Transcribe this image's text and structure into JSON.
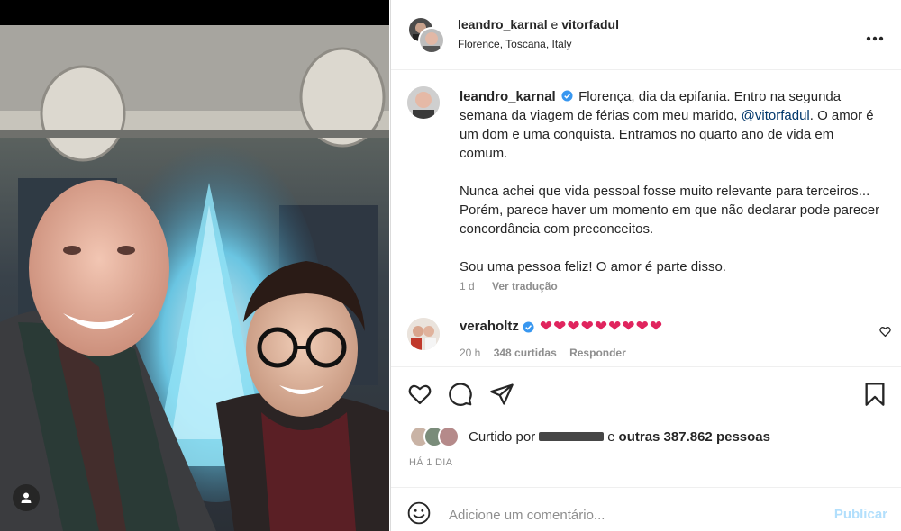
{
  "post": {
    "author": "leandro_karnal",
    "conjunction": "e",
    "coauthor": "vitorfadul",
    "location": "Florence, Toscana, Italy"
  },
  "caption": {
    "username": "leandro_karnal",
    "verified": true,
    "para1_before": "Florença, dia da epifania. Entro na segunda semana da viagem de férias com meu marido, ",
    "mention": "@vitorfadul",
    "para1_after": ". O amor é um dom e uma conquista. Entramos no quarto ano de vida em comum.",
    "para2": "Nunca achei que vida pessoal fosse muito relevante para terceiros... Porém, parece haver um momento em que não declarar pode parecer concordância com preconceitos.",
    "para3": "Sou uma pessoa feliz! O amor é parte disso.",
    "age": "1 d",
    "translate": "Ver tradução"
  },
  "comment": {
    "username": "veraholtz",
    "verified": true,
    "text": "❤❤❤❤❤❤❤❤❤",
    "age": "20 h",
    "likes": "348 curtidas",
    "reply": "Responder"
  },
  "likes": {
    "prefix": "Curtido por",
    "and": "e",
    "others": "outras 387.862 pessoas"
  },
  "timestamp": "HÁ 1 DIA",
  "comment_box": {
    "placeholder": "Adicione um comentário...",
    "publish": "Publicar"
  },
  "icons": {
    "more": "more-options-icon",
    "like": "heart-icon",
    "comment": "comment-icon",
    "share": "share-icon",
    "save": "bookmark-icon",
    "emoji": "emoji-icon",
    "tag": "user-tag-icon"
  },
  "colors": {
    "verified": "#3897f0",
    "heart": "#e0245e",
    "mention": "#00376b",
    "publish_disabled": "#b2dffc",
    "muted": "#8e8e8e"
  }
}
